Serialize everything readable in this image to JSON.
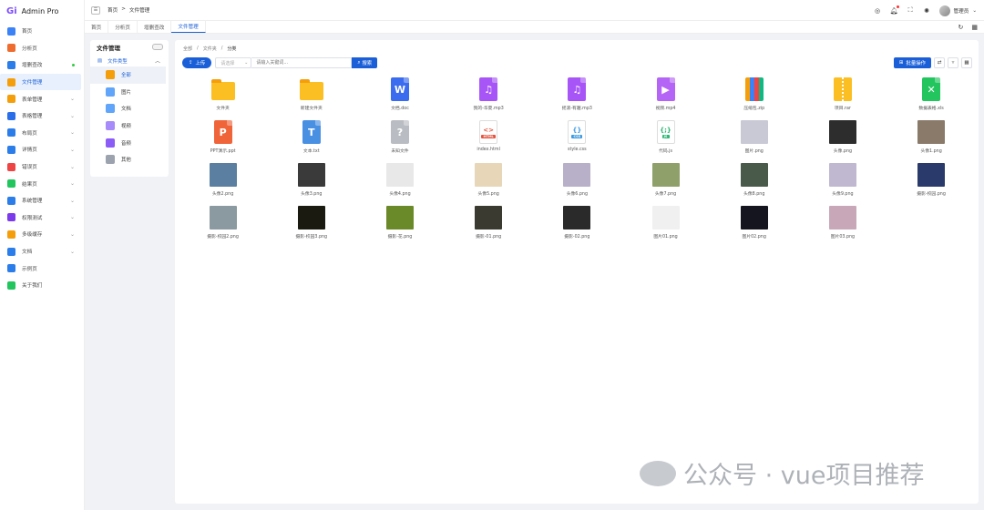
{
  "app": {
    "logo_mark": "Gi",
    "title": "Admin Pro"
  },
  "sidebar": {
    "items": [
      {
        "label": "首页",
        "color": "#3b82f6",
        "chevron": false
      },
      {
        "label": "分析页",
        "color": "#ef6c2f",
        "chevron": false
      },
      {
        "label": "增删查改",
        "color": "#2b7de9",
        "chevron": false,
        "dot": true
      },
      {
        "label": "文件管理",
        "color": "#f59e0b",
        "chevron": false,
        "active": true
      },
      {
        "label": "表单管理",
        "color": "#f59e0b",
        "chevron": true
      },
      {
        "label": "表格管理",
        "color": "#2b6ee9",
        "chevron": true
      },
      {
        "label": "布局页",
        "color": "#2b7de9",
        "chevron": true
      },
      {
        "label": "详情页",
        "color": "#2b7de9",
        "chevron": true
      },
      {
        "label": "错误页",
        "color": "#ef4444",
        "chevron": true
      },
      {
        "label": "结果页",
        "color": "#22c55e",
        "chevron": true
      },
      {
        "label": "系统管理",
        "color": "#2b7de9",
        "chevron": true
      },
      {
        "label": "权限测试",
        "color": "#7c3aed",
        "chevron": true
      },
      {
        "label": "多级缓存",
        "color": "#f59e0b",
        "chevron": true
      },
      {
        "label": "文档",
        "color": "#2b7de9",
        "chevron": true
      },
      {
        "label": "示例页",
        "color": "#2b7de9",
        "chevron": false
      },
      {
        "label": "关于我们",
        "color": "#22c55e",
        "chevron": false
      }
    ]
  },
  "header": {
    "breadcrumb": [
      "首页",
      "文件管理"
    ],
    "breadcrumb_sep": ">",
    "user_name": "管理员"
  },
  "tabs": [
    {
      "label": "首页"
    },
    {
      "label": "分析页"
    },
    {
      "label": "增删查改"
    },
    {
      "label": "文件管理",
      "active": true
    }
  ],
  "left_panel": {
    "title": "文件管理",
    "root_label": "文件类型",
    "items": [
      {
        "label": "全部",
        "color": "#f59e0b",
        "active": true
      },
      {
        "label": "图片",
        "color": "#60a5fa"
      },
      {
        "label": "文档",
        "color": "#60a5fa"
      },
      {
        "label": "视频",
        "color": "#a78bfa"
      },
      {
        "label": "音频",
        "color": "#8b5cf6"
      },
      {
        "label": "其他",
        "color": "#9ca3af"
      }
    ]
  },
  "main": {
    "breadcrumb": [
      "全部",
      "文件夹",
      "分类"
    ],
    "upload_label": "上传",
    "select_placeholder": "请选择",
    "search_placeholder": "请输入关键词...",
    "search_label": "搜索",
    "batch_label": "批量操作",
    "files": [
      {
        "name": "文件夹",
        "kind": "folder"
      },
      {
        "name": "新建文件夹",
        "kind": "folder"
      },
      {
        "name": "文档.doc",
        "kind": "doc",
        "color": "#3b6cf0",
        "glyph": "W"
      },
      {
        "name": "我的-华夏.mp3",
        "kind": "doc",
        "color": "#a855f7",
        "glyph": "♫"
      },
      {
        "name": "摇滚-有趣.mp3",
        "kind": "doc",
        "color": "#a855f7",
        "glyph": "♫"
      },
      {
        "name": "视频.mp4",
        "kind": "doc",
        "color": "#b565f5",
        "glyph": "▶"
      },
      {
        "name": "压缩包.zip",
        "kind": "zip"
      },
      {
        "name": "项目.rar",
        "kind": "rar"
      },
      {
        "name": "数据表格.xls",
        "kind": "doc",
        "color": "#22c55e",
        "glyph": "✕"
      },
      {
        "name": "PPT演示.ppt",
        "kind": "doc",
        "color": "#f0643a",
        "glyph": "P"
      },
      {
        "name": "文本.txt",
        "kind": "doc",
        "color": "#4a90e2",
        "glyph": "T"
      },
      {
        "name": "未知文件",
        "kind": "doc",
        "color": "#b9bcc2",
        "glyph": "?"
      },
      {
        "name": "index.html",
        "kind": "code",
        "color": "#e5533d",
        "glyph": "<>",
        "tag": "HTML"
      },
      {
        "name": "style.css",
        "kind": "code",
        "color": "#3b9ae1",
        "glyph": "{}",
        "tag": "CSS"
      },
      {
        "name": "代码.js",
        "kind": "code",
        "color": "#2bb673",
        "glyph": "{;}",
        "tag": "JS"
      },
      {
        "name": "图片.png",
        "kind": "photo",
        "color": "#c9c9d6"
      },
      {
        "name": "头像.png",
        "kind": "photo",
        "color": "#2d2d2d"
      },
      {
        "name": "头像1.png",
        "kind": "photo",
        "color": "#8a7a6a"
      },
      {
        "name": "头像2.png",
        "kind": "photo",
        "color": "#5a7fa0"
      },
      {
        "name": "头像3.png",
        "kind": "photo",
        "color": "#3a3a3a"
      },
      {
        "name": "头像4.png",
        "kind": "photo",
        "color": "#e8e8e8"
      },
      {
        "name": "头像5.png",
        "kind": "photo",
        "color": "#e8d6b8"
      },
      {
        "name": "头像6.png",
        "kind": "photo",
        "color": "#b8b0c8"
      },
      {
        "name": "头像7.png",
        "kind": "photo",
        "color": "#8fa06a"
      },
      {
        "name": "头像8.png",
        "kind": "photo",
        "color": "#4a5a4a"
      },
      {
        "name": "头像9.png",
        "kind": "photo",
        "color": "#c0b8d0"
      },
      {
        "name": "摄影-校园.png",
        "kind": "photo",
        "color": "#2a3a6a"
      },
      {
        "name": "摄影-校园2.png",
        "kind": "photo",
        "color": "#8a9aa0"
      },
      {
        "name": "摄影-校园3.png",
        "kind": "photo",
        "color": "#1a1a10"
      },
      {
        "name": "摄影-花.png",
        "kind": "photo",
        "color": "#6a8a2a"
      },
      {
        "name": "摄影-01.png",
        "kind": "photo",
        "color": "#3a3a30"
      },
      {
        "name": "摄影-02.png",
        "kind": "photo",
        "color": "#2a2a2a"
      },
      {
        "name": "图片01.png",
        "kind": "photo",
        "color": "#f0f0f0"
      },
      {
        "name": "图片02.png",
        "kind": "photo",
        "color": "#15151f"
      },
      {
        "name": "图片03.png",
        "kind": "photo",
        "color": "#c8a8b8"
      }
    ]
  },
  "watermark": {
    "text": "公众号 · vue项目推荐"
  }
}
